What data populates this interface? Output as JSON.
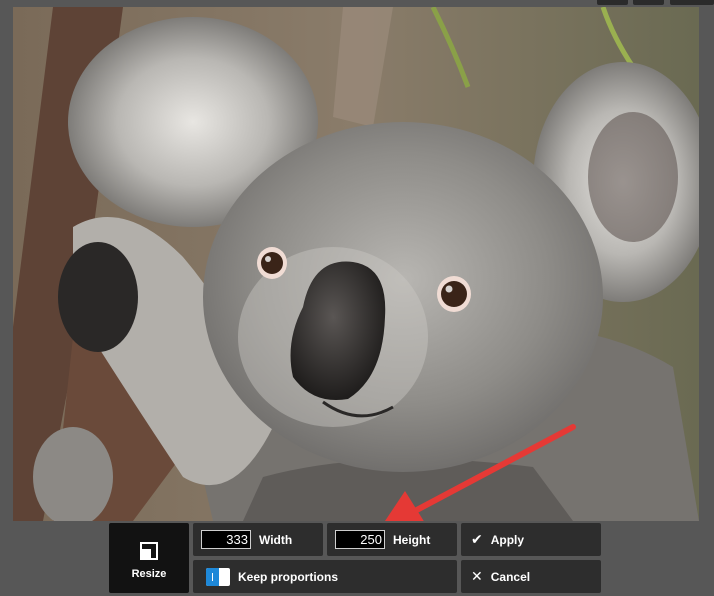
{
  "photo": {
    "subject": "koala"
  },
  "toolbar": {
    "resize_label": "Resize",
    "width": {
      "value": "333",
      "label": "Width"
    },
    "height": {
      "value": "250",
      "label": "Height"
    },
    "keep_proportions_label": "Keep proportions",
    "keep_proportions_on": true,
    "apply_label": "Apply",
    "cancel_label": "Cancel"
  },
  "icons": {
    "resize": "resize-icon",
    "apply": "checkmark-icon",
    "cancel": "close-icon",
    "toggle": "toggle-switch"
  },
  "colors": {
    "background": "#575757",
    "panel": "#2d2d2d",
    "resize_tile": "#121212",
    "toggle_accent": "#1e88d8",
    "annotation_arrow": "#e53935"
  }
}
